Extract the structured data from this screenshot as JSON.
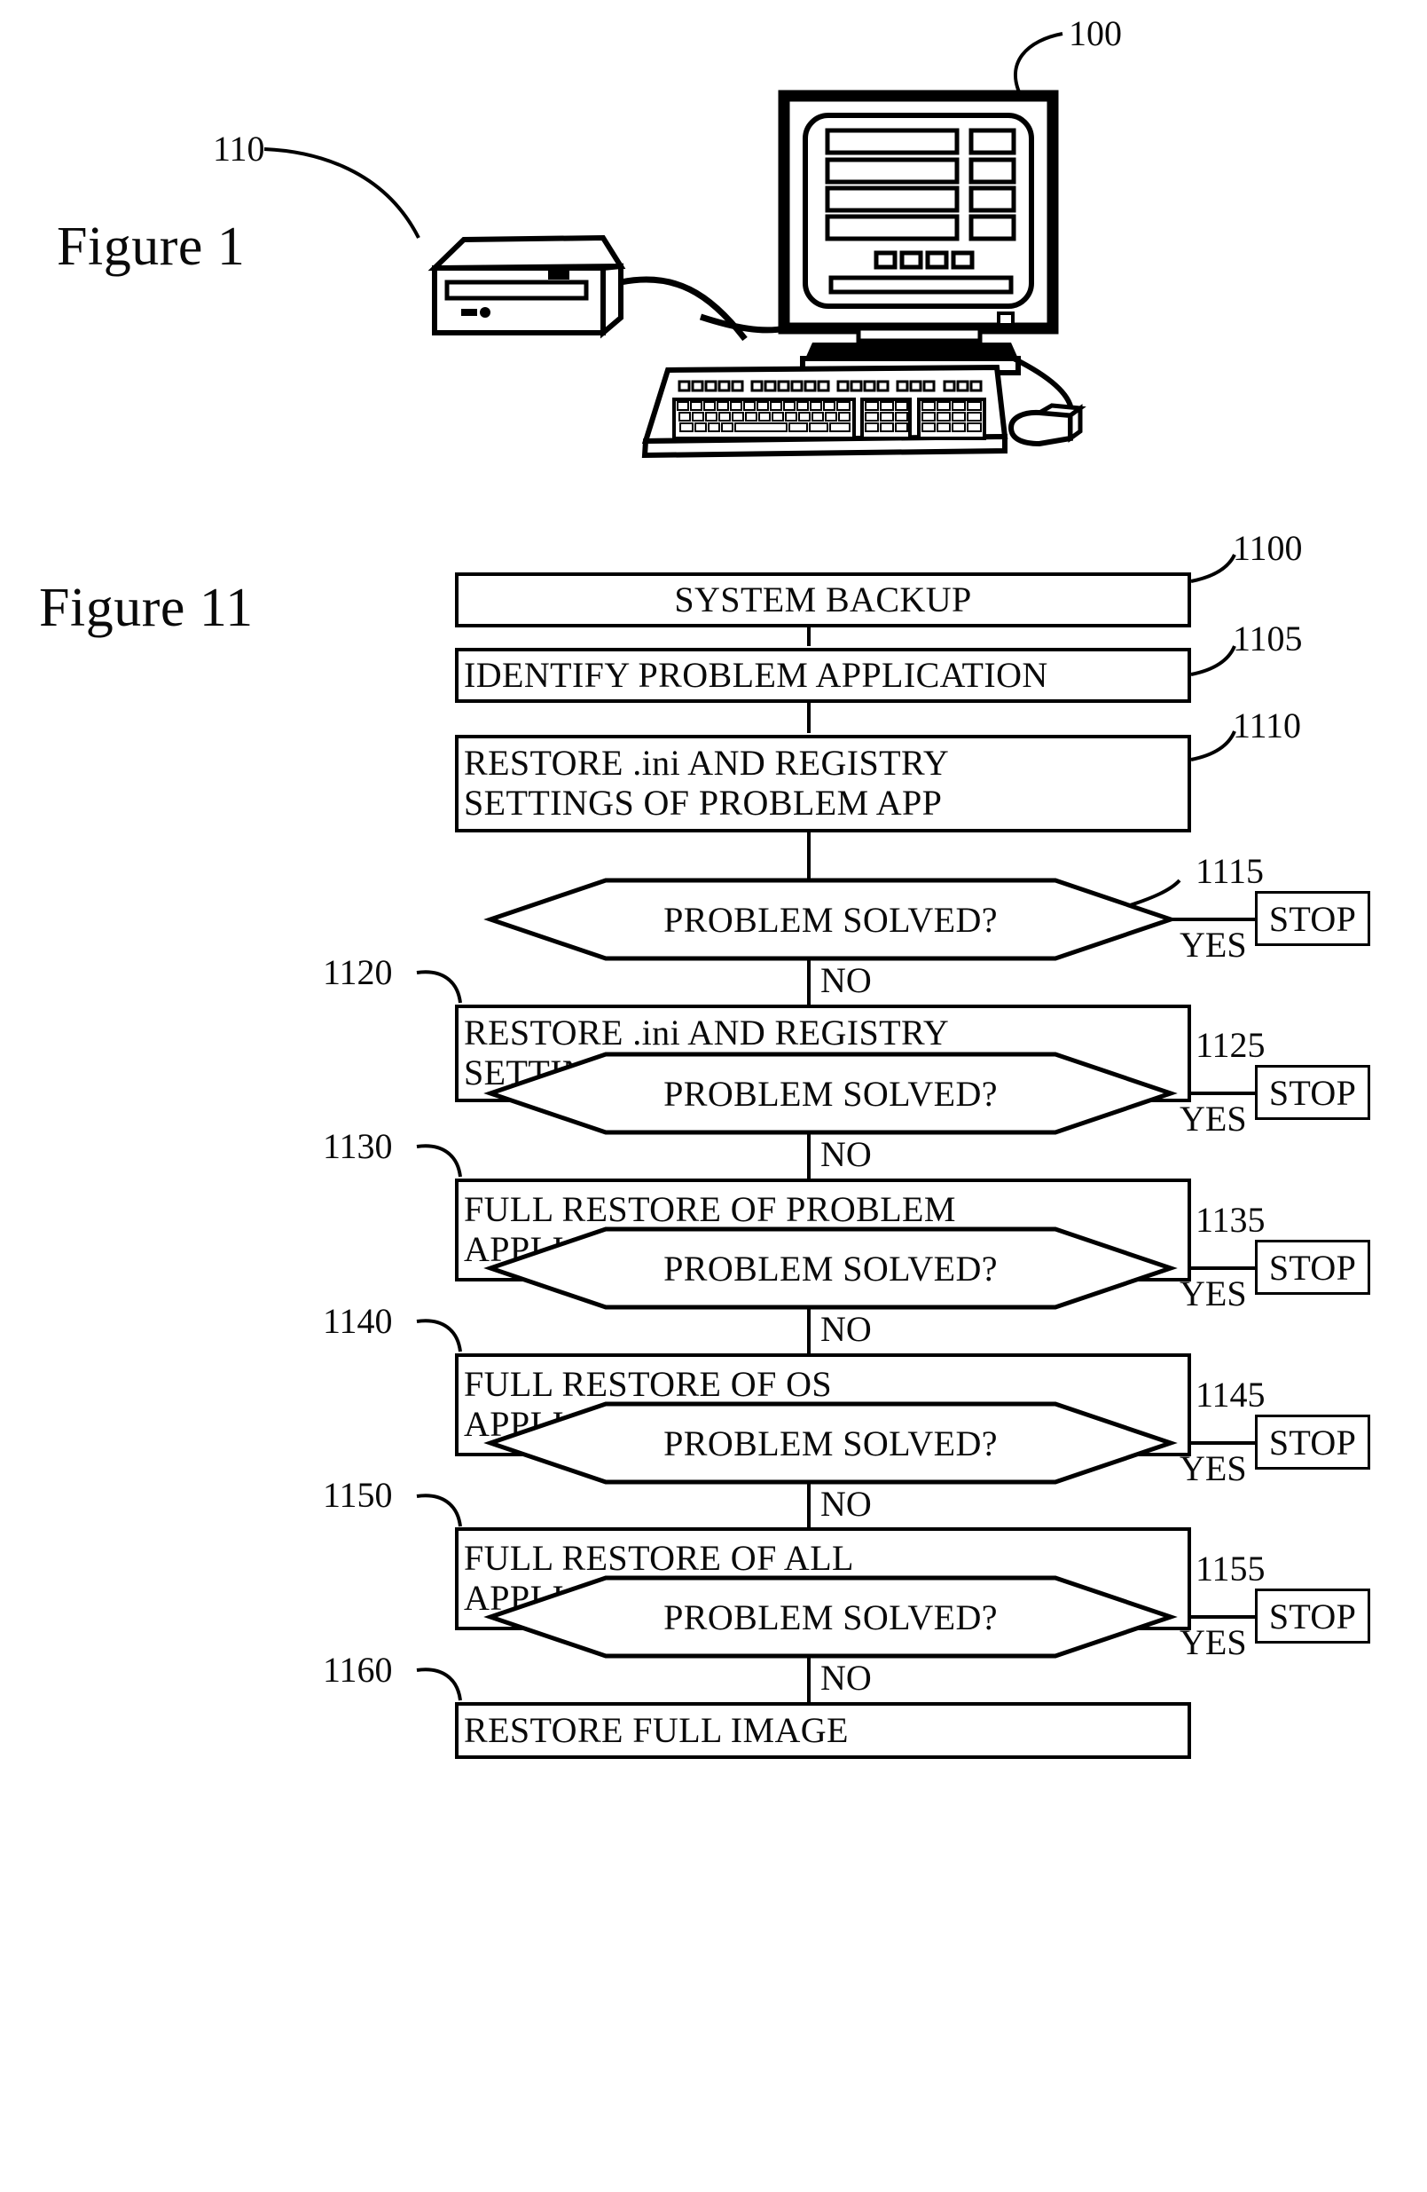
{
  "figure1": {
    "caption": "Figure 1",
    "refs": [
      {
        "id": "ref-100",
        "label": "100"
      },
      {
        "id": "ref-110",
        "label": "110"
      }
    ],
    "parts": {
      "monitor": "monitor",
      "base_unit": "base-unit",
      "keyboard": "keyboard",
      "mouse": "mouse",
      "screen_rows": 4,
      "screen_buttons": 4,
      "screen_small_squares": 4
    }
  },
  "figure11": {
    "caption": "Figure 11",
    "nodes": [
      {
        "ref": "1100",
        "type": "process",
        "align": "center",
        "lines": [
          "SYSTEM BACKUP"
        ]
      },
      {
        "ref": "1105",
        "type": "process",
        "align": "left",
        "lines": [
          "IDENTIFY PROBLEM APPLICATION"
        ]
      },
      {
        "ref": "1110",
        "type": "process",
        "align": "left",
        "lines": [
          "RESTORE .ini AND REGISTRY",
          "SETTINGS OF PROBLEM APP"
        ]
      },
      {
        "ref": "1115",
        "type": "decision",
        "lines": [
          "PROBLEM SOLVED?"
        ],
        "yes_label": "YES",
        "no_label": "NO",
        "yes_target": "STOP"
      },
      {
        "ref": "1120",
        "type": "process",
        "align": "left",
        "lines": [
          "RESTORE .ini AND REGISTRY",
          "SETTINGS ALL APPLICATIONS"
        ]
      },
      {
        "ref": "1125",
        "type": "decision",
        "lines": [
          "PROBLEM SOLVED?"
        ],
        "yes_label": "YES",
        "no_label": "NO",
        "yes_target": "STOP"
      },
      {
        "ref": "1130",
        "type": "process",
        "align": "left",
        "lines": [
          "FULL RESTORE OF PROBLEM",
          "APPLICATION"
        ]
      },
      {
        "ref": "1135",
        "type": "decision",
        "lines": [
          "PROBLEM SOLVED?"
        ],
        "yes_label": "YES",
        "no_label": "NO",
        "yes_target": "STOP"
      },
      {
        "ref": "1140",
        "type": "process",
        "align": "left",
        "lines": [
          "FULL RESTORE OF OS",
          "APPLICATIONS"
        ]
      },
      {
        "ref": "1145",
        "type": "decision",
        "lines": [
          "PROBLEM SOLVED?"
        ],
        "yes_label": "YES",
        "no_label": "NO",
        "yes_target": "STOP"
      },
      {
        "ref": "1150",
        "type": "process",
        "align": "left",
        "lines": [
          "FULL RESTORE OF ALL",
          "APPLICATIONS"
        ]
      },
      {
        "ref": "1155",
        "type": "decision",
        "lines": [
          "PROBLEM SOLVED?"
        ],
        "yes_label": "YES",
        "no_label": "NO",
        "yes_target": "STOP"
      },
      {
        "ref": "1160",
        "type": "process",
        "align": "left",
        "lines": [
          "RESTORE FULL IMAGE"
        ]
      }
    ],
    "stop_label": "STOP",
    "yes_label": "YES",
    "no_label": "NO"
  },
  "colors": {
    "ink": "#000000",
    "paper": "#ffffff"
  }
}
